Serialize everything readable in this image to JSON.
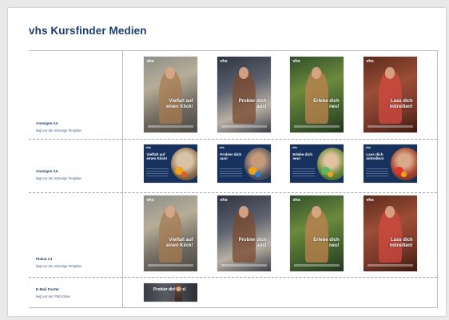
{
  "title": "vhs Kursfinder Medien",
  "rows": [
    {
      "label": "Anzeigen A4",
      "sub": "liegt vor als: InDesign Template"
    },
    {
      "label": "Anzeigen A5",
      "sub": "liegt vor als: InDesign Template"
    },
    {
      "label": "Plakat A1",
      "sub": "liegt vor als: InDesign Template"
    },
    {
      "label": "E-Mail Footer",
      "sub": "liegt vor als: PNG-Datei"
    }
  ],
  "logo": "vhs",
  "claims": [
    "Vielfalt auf einen Klick!",
    "Probier dich aus!",
    "Erlebe dich neu!",
    "Lass dich mitreißen!"
  ],
  "footer_claim": "Probier dich aus!",
  "colors": {
    "title": "#1e3d6b",
    "a5_background": "#18325e"
  },
  "poster_themes": [
    {
      "bg": "linear-gradient(160deg,#8c8f8a 0%,#b7ad98 35%,#6f6a5f 70%,#4c4a45 100%)",
      "body": "#a77b52"
    },
    {
      "bg": "linear-gradient(160deg,#2f3340 0%,#5d6270 40%,#b8b0a4 70%,#3c3f48 100%)",
      "body": "#7b4a2e"
    },
    {
      "bg": "linear-gradient(160deg,#2f4e2a 0%,#6b8a3d 40%,#3f5d2c 75%,#23351f 100%)",
      "body": "#c0834f"
    },
    {
      "bg": "linear-gradient(160deg,#5b2a1d 0%,#9c4d36 40%,#7c3a29 70%,#3b1a12 100%)",
      "body": "#d14a40"
    }
  ],
  "a5_circles": [
    {
      "bg": "radial-gradient(circle at 45% 40%,#d8c3a6 0 30%,#8b6b4b 60%,#4a3b2c 100%)",
      "a": "#f0a11c",
      "b": "#e05b2a"
    },
    {
      "bg": "radial-gradient(circle at 45% 40%,#c59a7a 0 25%,#4f5563 60%,#2b2f38 100%)",
      "a": "#f0a11c",
      "b": "#2b7fd1"
    },
    {
      "bg": "radial-gradient(circle at 45% 40%,#e0c2a0 0 25%,#6b8a3d 55%,#2f4e2a 100%)",
      "a": "#5cb85c",
      "b": "#f0a11c"
    },
    {
      "bg": "radial-gradient(circle at 45% 40%,#d8a88a 0 25%,#a5462f 55%,#5b2a1d 100%)",
      "a": "#e0342a",
      "b": "#f0a11c"
    }
  ]
}
